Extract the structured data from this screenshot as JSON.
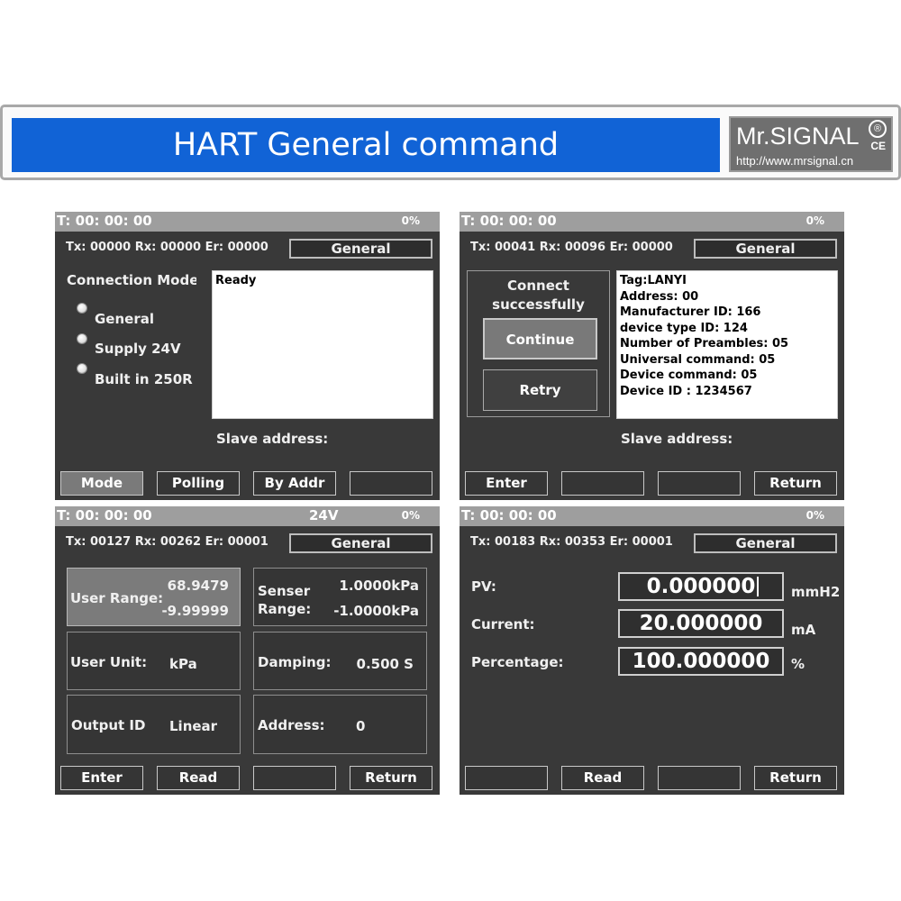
{
  "banner": {
    "title": "HART General command",
    "logo": {
      "name": "Mr.SIGNAL",
      "registered": "®",
      "ce": "CE",
      "url": "http://www.mrsignal.cn"
    }
  },
  "screens": [
    {
      "timer": "T: 00: 00: 00",
      "percent": "0%",
      "counts": "Tx: 00000  Rx: 00000  Er: 00000",
      "command": "General",
      "connection_label": "Connection Mode",
      "radios": [
        "General",
        "Supply 24V",
        "Built in 250R"
      ],
      "info_lines": [
        "Ready"
      ],
      "slave_label": "Slave address:",
      "softkeys": [
        "Mode",
        "Polling",
        "By Addr",
        ""
      ]
    },
    {
      "timer": "T: 00: 00: 00",
      "percent": "0%",
      "counts": "Tx: 00041  Rx: 00096  Er: 00000",
      "command": "General",
      "status_line1": "Connect",
      "status_line2": "successfully",
      "continue_label": "Continue",
      "retry_label": "Retry",
      "info_lines": [
        "Tag:LANYI",
        "Address: 00",
        "Manufacturer ID: 166",
        "device type ID: 124",
        "Number of Preambles: 05",
        "Universal command: 05",
        "Device command: 05",
        "Device ID : 1234567"
      ],
      "slave_label": "Slave address:",
      "softkeys": [
        "Enter",
        "",
        "",
        "Return"
      ]
    },
    {
      "timer": "T: 00: 00: 00",
      "voltage": "24V",
      "percent": "0%",
      "counts": "Tx: 00127  Rx: 00262  Er: 00001",
      "command": "General",
      "user_range": {
        "label": "User Range:",
        "upper": "68.9479",
        "lower": "-9.99999"
      },
      "sensor_range": {
        "label1": "Senser",
        "label2": "Range:",
        "upper": "1.0000kPa",
        "lower": "-1.0000kPa"
      },
      "user_unit": {
        "label": "User Unit:",
        "value": "kPa"
      },
      "damping": {
        "label": "Damping:",
        "value": "0.500 S"
      },
      "output_id": {
        "label": "Output ID",
        "value": "Linear"
      },
      "address": {
        "label": "Address:",
        "value": "0"
      },
      "softkeys": [
        "Enter",
        "Read",
        "",
        "Return"
      ]
    },
    {
      "timer": "T: 00: 00: 00",
      "percent": "0%",
      "counts": "Tx: 00183  Rx: 00353  Er: 00001",
      "command": "General",
      "rows": [
        {
          "label": "PV:",
          "value": "0.000000",
          "unit": "mmH2"
        },
        {
          "label": "Current:",
          "value": "20.000000",
          "unit": "mA"
        },
        {
          "label": "Percentage:",
          "value": "100.000000",
          "unit": "%"
        }
      ],
      "softkeys": [
        "",
        "Read",
        "",
        "Return"
      ]
    }
  ]
}
